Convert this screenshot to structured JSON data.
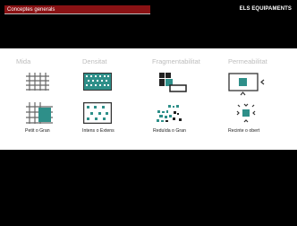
{
  "header": {
    "section_title": "Conceptes generals",
    "deck_title": "ELS EQUIPAMENTS"
  },
  "concepts": [
    {
      "heading": "Mida",
      "caption": "Petit  o Gran"
    },
    {
      "heading": "Densitat",
      "caption": "Intens o Extens"
    },
    {
      "heading": "Fragmentabilitat",
      "caption": "Reduïda o  Gran"
    },
    {
      "heading": "Permeabilitat",
      "caption": "Recinte o obert"
    }
  ],
  "colors": {
    "accent": "#8a1214",
    "teal": "#2e8f89",
    "heading": "#bdbdbd"
  }
}
